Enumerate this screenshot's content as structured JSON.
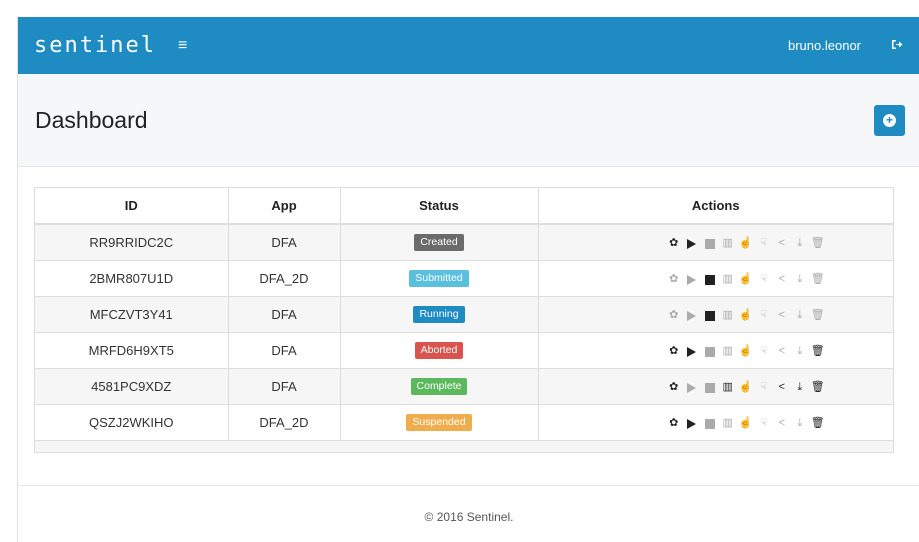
{
  "navbar": {
    "brand": "sentinel",
    "menu_icon": "≡",
    "username": "bruno.leonor",
    "logout_icon": "sign-out-icon"
  },
  "header": {
    "title": "Dashboard",
    "add_icon": "plus-circle-icon"
  },
  "table": {
    "columns": [
      "ID",
      "App",
      "Status",
      "Actions"
    ],
    "rows": [
      {
        "id": "RR9RRIDC2C",
        "app": "DFA",
        "status": "Created",
        "status_color": "#6b6b6b",
        "actions": [
          1,
          1,
          0,
          0,
          0,
          0,
          0,
          0,
          0
        ]
      },
      {
        "id": "2BMR807U1D",
        "app": "DFA_2D",
        "status": "Submitted",
        "status_color": "#5bc0de",
        "actions": [
          0,
          0,
          1,
          0,
          0,
          0,
          0,
          0,
          0
        ]
      },
      {
        "id": "MFCZVT3Y41",
        "app": "DFA",
        "status": "Running",
        "status_color": "#1e8bc3",
        "actions": [
          0,
          0,
          1,
          0,
          0,
          0,
          0,
          0,
          0
        ]
      },
      {
        "id": "MRFD6H9XT5",
        "app": "DFA",
        "status": "Aborted",
        "status_color": "#d9534f",
        "actions": [
          1,
          1,
          0,
          0,
          0,
          0,
          0,
          0,
          1
        ]
      },
      {
        "id": "4581PC9XDZ",
        "app": "DFA",
        "status": "Complete",
        "status_color": "#5cb85c",
        "actions": [
          1,
          0,
          0,
          1,
          1,
          0,
          1,
          1,
          1
        ]
      },
      {
        "id": "QSZJ2WKIHO",
        "app": "DFA_2D",
        "status": "Suspended",
        "status_color": "#f0ad4e",
        "actions": [
          1,
          1,
          0,
          0,
          0,
          0,
          0,
          0,
          1
        ]
      }
    ],
    "action_icons": [
      "gear-icon",
      "play-icon",
      "stop-icon",
      "bar-chart-icon",
      "thumbs-up-icon",
      "thumbs-down-icon",
      "share-icon",
      "download-icon",
      "trash-icon"
    ]
  },
  "footer": {
    "text": "© 2016 Sentinel."
  }
}
